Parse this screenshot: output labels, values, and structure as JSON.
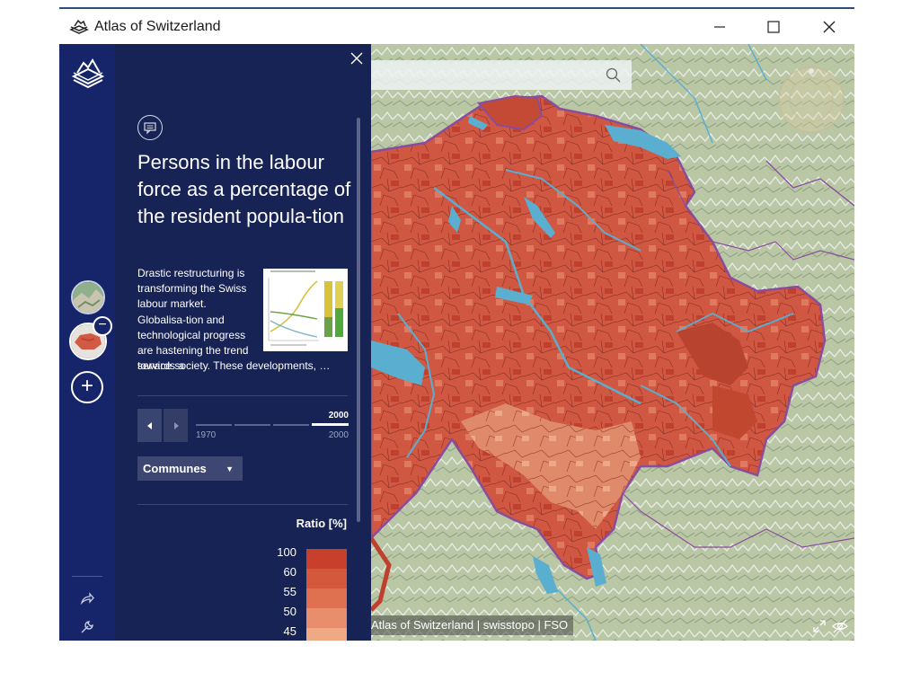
{
  "window": {
    "title": "Atlas of Switzerland",
    "controls": [
      "minimize-icon",
      "maximize-icon",
      "close-icon"
    ]
  },
  "rail": {
    "logo_icon": "atlas-logo-icon",
    "bottom_icons": [
      "share-icon",
      "wrench-icon"
    ]
  },
  "panel": {
    "header_icon": "map-info-icon",
    "title": "Persons in the labour force as a percentage of the resident popula-tion",
    "description": "Drastic restructuring is transforming the Swiss labour market. Globalisa-tion and technological progress are hastening the trend towards a",
    "description_more": "service society. These developments, …",
    "time_slider": {
      "current": "2000",
      "start_label": "1970",
      "end_label": "2000"
    },
    "level_select": {
      "selected": "Communes"
    },
    "legend": {
      "title": "Ratio [%]",
      "entries": [
        {
          "label": "100",
          "color": "#c8402c"
        },
        {
          "label": "60",
          "color": "#d4583c"
        },
        {
          "label": "55",
          "color": "#df7151"
        },
        {
          "label": "50",
          "color": "#e98e6c"
        },
        {
          "label": "45",
          "color": "#efa985"
        }
      ]
    }
  },
  "map": {
    "search_icon": "search-icon",
    "compass_icon": "compass-icon",
    "attribution": "Atlas of Switzerland | swisstopo | FSO",
    "corner_icons": [
      "fullscreen-icon",
      "hide-icon"
    ]
  },
  "colors": {
    "rail_bg": "#16246a",
    "panel_bg": "#172355",
    "map_fill": "#d25a45",
    "border_purple": "#8a4c9c",
    "water": "#5aaed0"
  }
}
